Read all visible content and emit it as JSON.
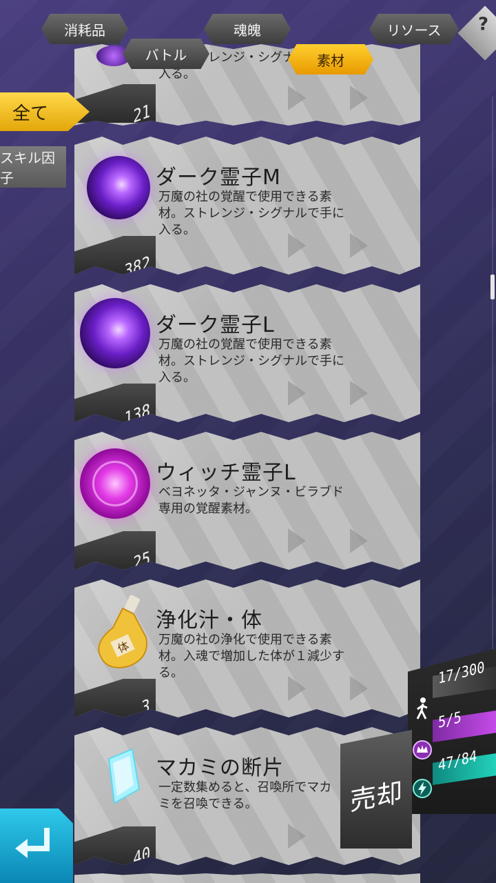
{
  "tabs": [
    {
      "label": "消耗品",
      "active": false
    },
    {
      "label": "バトル",
      "active": false
    },
    {
      "label": "魂魄",
      "active": false
    },
    {
      "label": "素材",
      "active": true
    },
    {
      "label": "リソース",
      "active": false
    }
  ],
  "help_label": "?",
  "filters": {
    "all_label": "全て",
    "skill_label": "スキル因子"
  },
  "items": [
    {
      "name": "",
      "desc": "社の覚醒で使用できる素材。ストレンジ・シグナルで手に入る。",
      "desc_visible": "材。ストレンジ・シグナルで手に入る。",
      "count": "21",
      "icon": "dark-orb-small-icon"
    },
    {
      "name": "ダーク霊子M",
      "desc": "万魔の社の覚醒で使用できる素材。ストレンジ・シグナルで手に入る。",
      "count": "382",
      "icon": "dark-orb-medium-icon"
    },
    {
      "name": "ダーク霊子L",
      "desc": "万魔の社の覚醒で使用できる素材。ストレンジ・シグナルで手に入る。",
      "count": "138",
      "icon": "dark-orb-large-icon"
    },
    {
      "name": "ウィッチ霊子L",
      "desc": "ベヨネッタ・ジャンヌ・ビラブド専用の覚醒素材。",
      "count": "25",
      "icon": "witch-orb-icon"
    },
    {
      "name": "浄化汁・体",
      "desc": "万魔の社の浄化で使用できる素材。入魂で増加した体が１減少する。",
      "count": "3",
      "icon": "purify-bottle-icon"
    },
    {
      "name": "マカミの断片",
      "desc": "一定数集めると、召喚所でマカミを召喚できる。",
      "count": "40",
      "icon": "crystal-shard-icon"
    }
  ],
  "status": {
    "stamina": "17/300",
    "rank": "5/5",
    "energy": "47/84"
  },
  "sell_label": "売却",
  "colors": {
    "accent_active": "#f4b51c",
    "back_button": "#1aa8d3",
    "rank_bar": "#b23cd6",
    "energy_bar": "#19b8a6"
  }
}
